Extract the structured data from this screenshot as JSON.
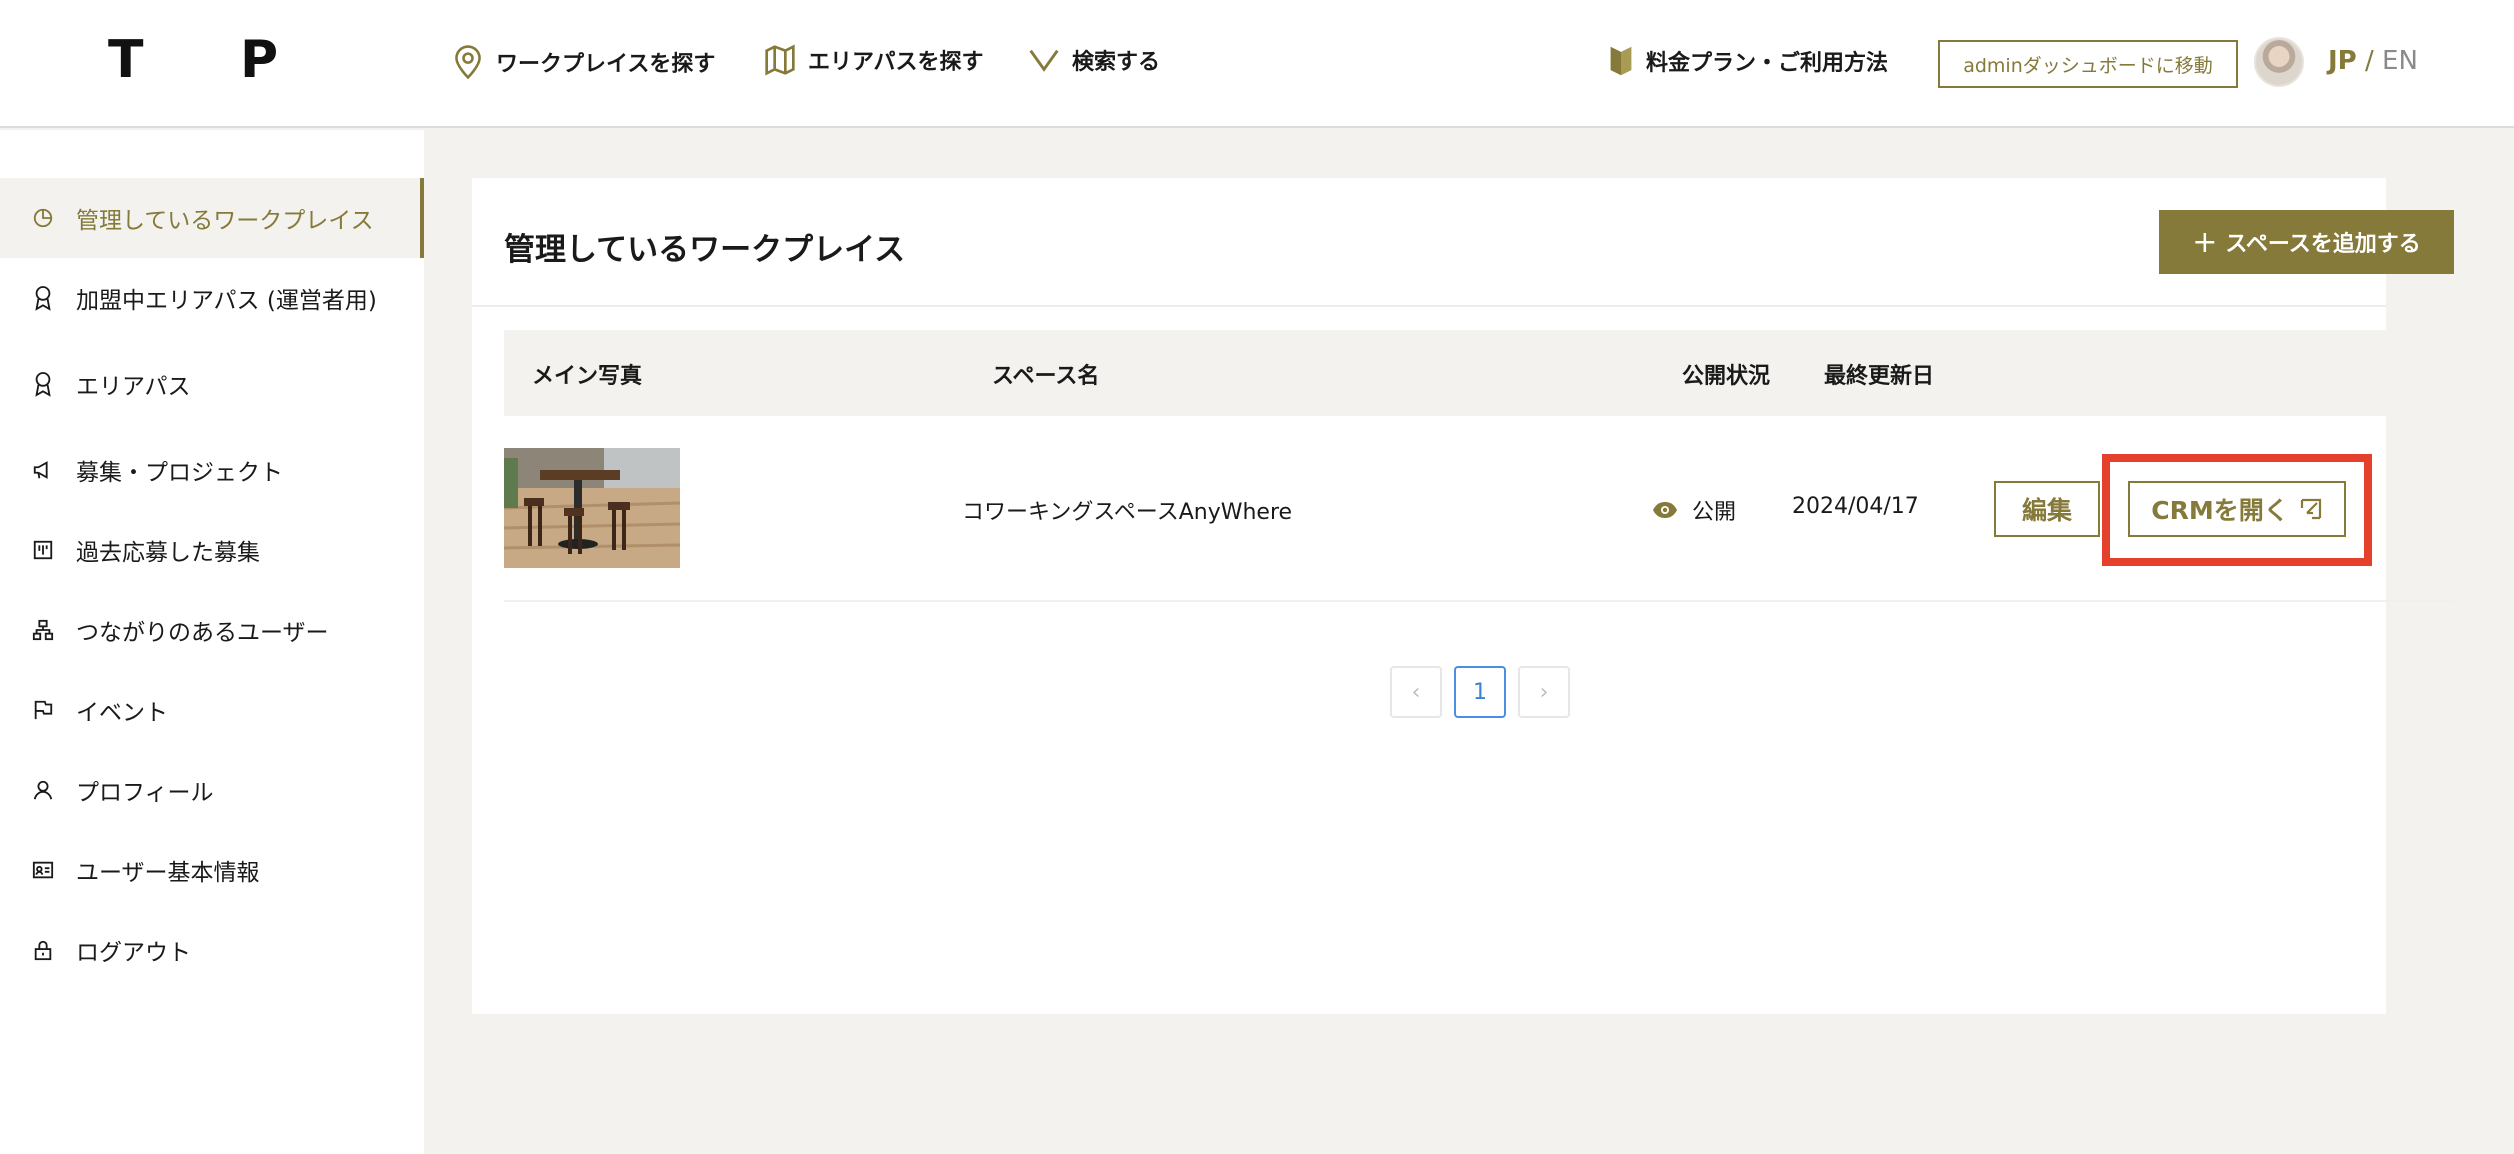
{
  "header": {
    "logo_left": "T",
    "logo_right": "P",
    "nav": [
      {
        "label": "ワークプレイスを探す",
        "icon": "map-pin-icon"
      },
      {
        "label": "エリアパスを探す",
        "icon": "map-icon"
      },
      {
        "label": "検索する",
        "icon": "chevron-down-icon"
      }
    ],
    "plans_label": "料金プラン・ご利用方法",
    "admin_label": "adminダッシュボードに移動",
    "lang_jp": "JP",
    "lang_sep": " / ",
    "lang_en": "EN"
  },
  "sidebar": {
    "items": [
      {
        "label": "管理しているワークプレイス",
        "icon": "pie-chart-icon",
        "active": true
      },
      {
        "label": "加盟中エリアパス (運営者用)",
        "icon": "award-icon"
      },
      {
        "label": "エリアパス",
        "icon": "award-icon"
      },
      {
        "label": "募集・プロジェクト",
        "icon": "megaphone-icon"
      },
      {
        "label": "過去応募した募集",
        "icon": "board-icon"
      },
      {
        "label": "つながりのあるユーザー",
        "icon": "network-icon"
      },
      {
        "label": "イベント",
        "icon": "flag-icon"
      },
      {
        "label": "プロフィール",
        "icon": "user-icon"
      },
      {
        "label": "ユーザー基本情報",
        "icon": "id-card-icon"
      },
      {
        "label": "ログアウト",
        "icon": "lock-icon"
      }
    ]
  },
  "main": {
    "title": "管理しているワークプレイス",
    "add_button": "スペースを追加する",
    "add_symbol": "+",
    "columns": {
      "photo": "メイン写真",
      "name": "スペース名",
      "status": "公開状況",
      "updated": "最終更新日"
    },
    "rows": [
      {
        "name": "コワーキングスペースAnyWhere",
        "status": "公開",
        "updated": "2024/04/17",
        "edit": "編集",
        "crm": "CRMを開く"
      }
    ],
    "pagination": {
      "prev": "‹",
      "current": "1",
      "next": "›"
    }
  },
  "colors": {
    "accent": "#857a3a",
    "highlight": "#e5402c",
    "page_bg": "#f3f2ee"
  }
}
